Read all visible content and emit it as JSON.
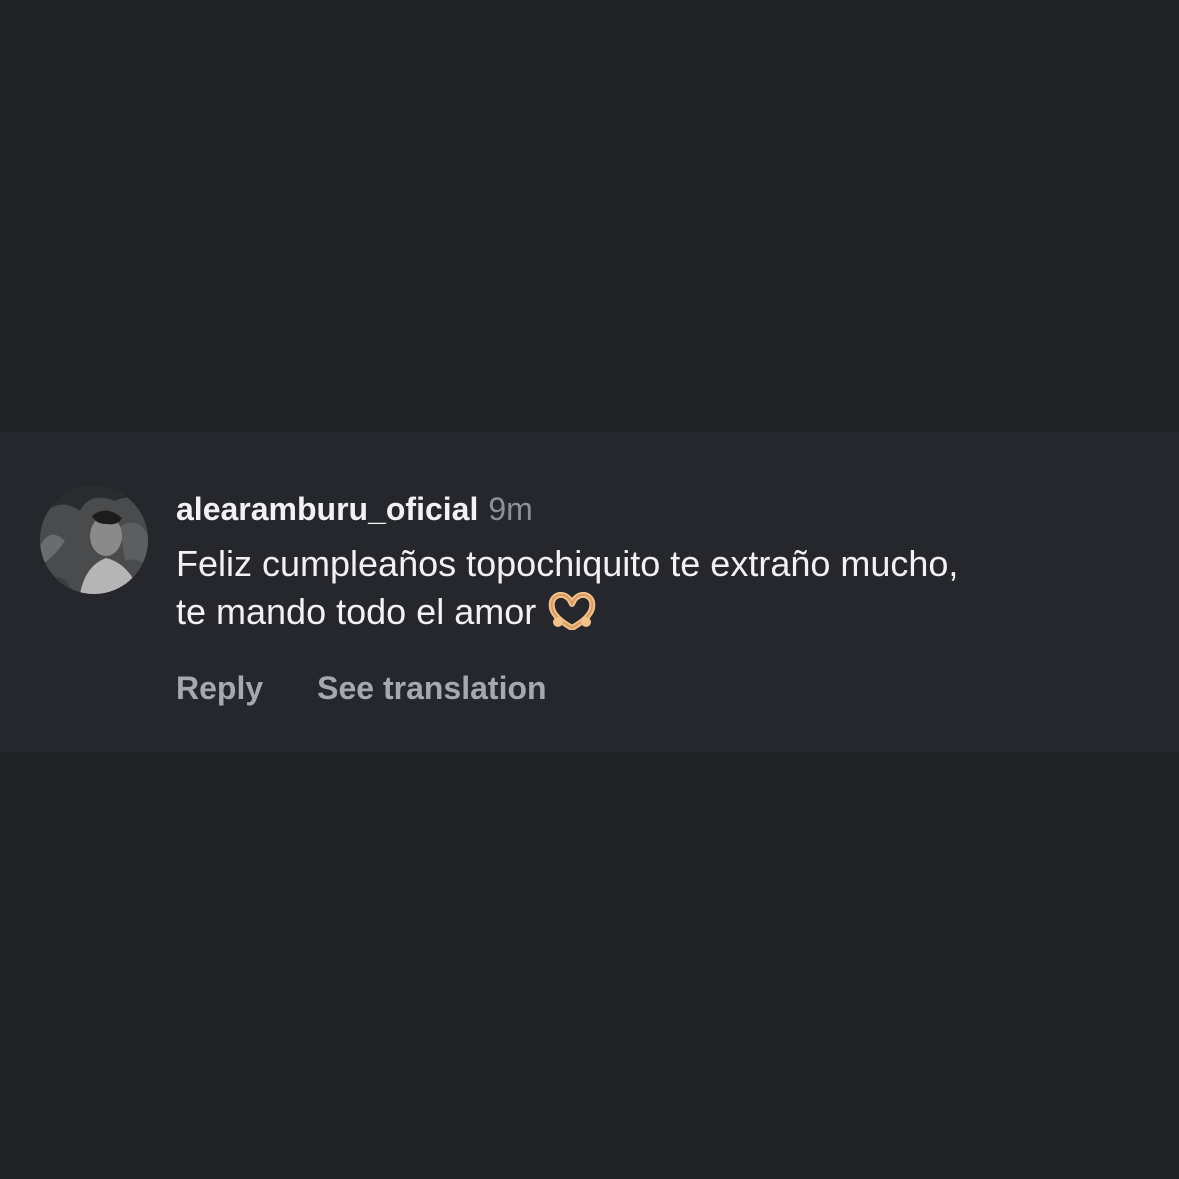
{
  "comment": {
    "username": "alearamburu_oficial",
    "timestamp": "9m",
    "text_line_1": "Feliz cumpleaños topochiquito te extraño mucho,",
    "text_line_2": "te mando todo el amor",
    "emoji": "heart-hands-emoji",
    "actions": {
      "reply": "Reply",
      "see_translation": "See translation"
    }
  },
  "colors": {
    "background": "#222326",
    "card": "#25272d",
    "primary_text": "#f2f2f2",
    "secondary_text": "#8e8f94",
    "action_text": "#a6a8ad"
  }
}
